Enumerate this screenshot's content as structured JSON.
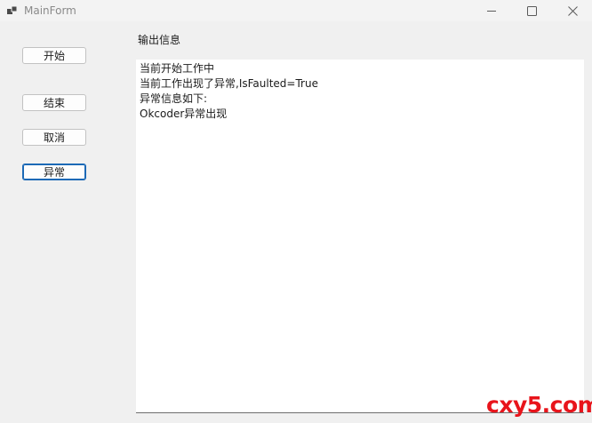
{
  "window": {
    "title": "MainForm",
    "icon": "winforms-app-icon",
    "controls": {
      "minimize": "minimize-icon",
      "maximize": "maximize-icon",
      "close": "close-icon"
    }
  },
  "buttons": {
    "start": "开始",
    "end": "结束",
    "cancel": "取消",
    "error": "异常",
    "focused": "error"
  },
  "output": {
    "label": "输出信息",
    "lines": [
      "当前开始工作中",
      "当前工作出现了异常,IsFaulted=True",
      "异常信息如下:",
      "Okcoder异常出现"
    ]
  },
  "watermark": {
    "text": "cxy5.com",
    "color": "#e8141b"
  },
  "colors": {
    "focus_accent": "#1c69b6",
    "background": "#f0f0f0",
    "textbox": "#ffffff"
  }
}
